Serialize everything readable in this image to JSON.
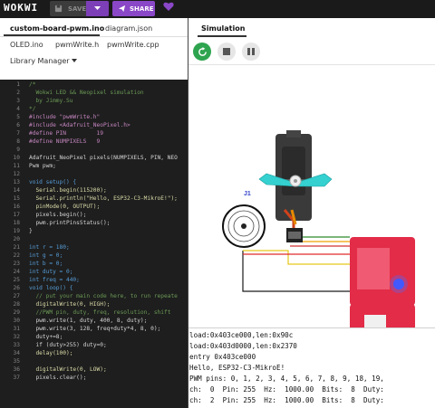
{
  "app": {
    "logo": "WOKWI",
    "save_label": "SAVE",
    "share_label": "SHARE",
    "colors": {
      "accent": "#8a47c7",
      "bg": "#1e1e1e"
    }
  },
  "editor": {
    "tabs": [
      "custom-board-pwm.ino",
      "diagram.json",
      "OLED.ino",
      "pwmWrite.h",
      "pwmWrite.cpp",
      "Library Manager"
    ],
    "code_lines": [
      {
        "num": "1",
        "text": "/*"
      },
      {
        "num": "2",
        "text": "  Wokwi LED && Neopixel simulation"
      },
      {
        "num": "3",
        "text": "  by Jimmy.Su"
      },
      {
        "num": "4",
        "text": "*/"
      },
      {
        "num": "5",
        "text": "#include \"pwmWrite.h\""
      },
      {
        "num": "6",
        "text": "#include <Adafruit_NeoPixel.h>"
      },
      {
        "num": "7",
        "text": "#define PIN         19"
      },
      {
        "num": "8",
        "text": "#define NUMPIXELS   9"
      },
      {
        "num": "9",
        "text": ""
      },
      {
        "num": "10",
        "text": "Adafruit_NeoPixel pixels(NUMPIXELS, PIN, NEO"
      },
      {
        "num": "11",
        "text": "Pwm pwm;"
      },
      {
        "num": "12",
        "text": ""
      },
      {
        "num": "13",
        "text": "void setup() {"
      },
      {
        "num": "14",
        "text": "  Serial.begin(115200);"
      },
      {
        "num": "15",
        "text": "  Serial.println(\"Hello, ESP32-C3-MikroE!\");"
      },
      {
        "num": "16",
        "text": "  pinMode(0, OUTPUT);"
      },
      {
        "num": "17",
        "text": "  pixels.begin();"
      },
      {
        "num": "18",
        "text": "  pwm.printPinsStatus();"
      },
      {
        "num": "19",
        "text": "}"
      },
      {
        "num": "20",
        "text": ""
      },
      {
        "num": "21",
        "text": "int r = 180;"
      },
      {
        "num": "22",
        "text": "int g = 0;"
      },
      {
        "num": "23",
        "text": "int b = 0;"
      },
      {
        "num": "24",
        "text": "int duty = 0;"
      },
      {
        "num": "25",
        "text": "int freq = 440;"
      },
      {
        "num": "26",
        "text": "void loop() {"
      },
      {
        "num": "27",
        "text": "  // put your main code here, to run repeate"
      },
      {
        "num": "28",
        "text": "  digitalWrite(0, HIGH);"
      },
      {
        "num": "29",
        "text": "  //PWM pin, duty, freq, resolution, shift"
      },
      {
        "num": "30",
        "text": "  pwm.write(1, duty, 400, 8, duty);"
      },
      {
        "num": "31",
        "text": "  pwm.write(3, 128, freq+duty*4, 8, 0);"
      },
      {
        "num": "32",
        "text": "  duty+=8;"
      },
      {
        "num": "33",
        "text": "  if (duty>255) duty=0;"
      },
      {
        "num": "34",
        "text": "  delay(100);"
      },
      {
        "num": "35",
        "text": ""
      },
      {
        "num": "36",
        "text": "  digitalWrite(0, LOW);"
      },
      {
        "num": "37",
        "text": "  pixels.clear();"
      }
    ]
  },
  "simulation": {
    "tab_label": "Simulation",
    "servo_label": "J1",
    "serial_lines": [
      "load:0x403ce000,len:0x90c",
      "load:0x403d0000,len:0x2370",
      "entry 0x403ce000",
      "Hello, ESP32-C3-MikroE!",
      "PWM pins: 0, 1, 2, 3, 4, 5, 6, 7, 8, 9, 18, 19,",
      "ch:  0  Pin: 255  Hz:  1000.00  Bits:  8  Duty:",
      "ch:  2  Pin: 255  Hz:  1000.00  Bits:  8  Duty:"
    ]
  }
}
